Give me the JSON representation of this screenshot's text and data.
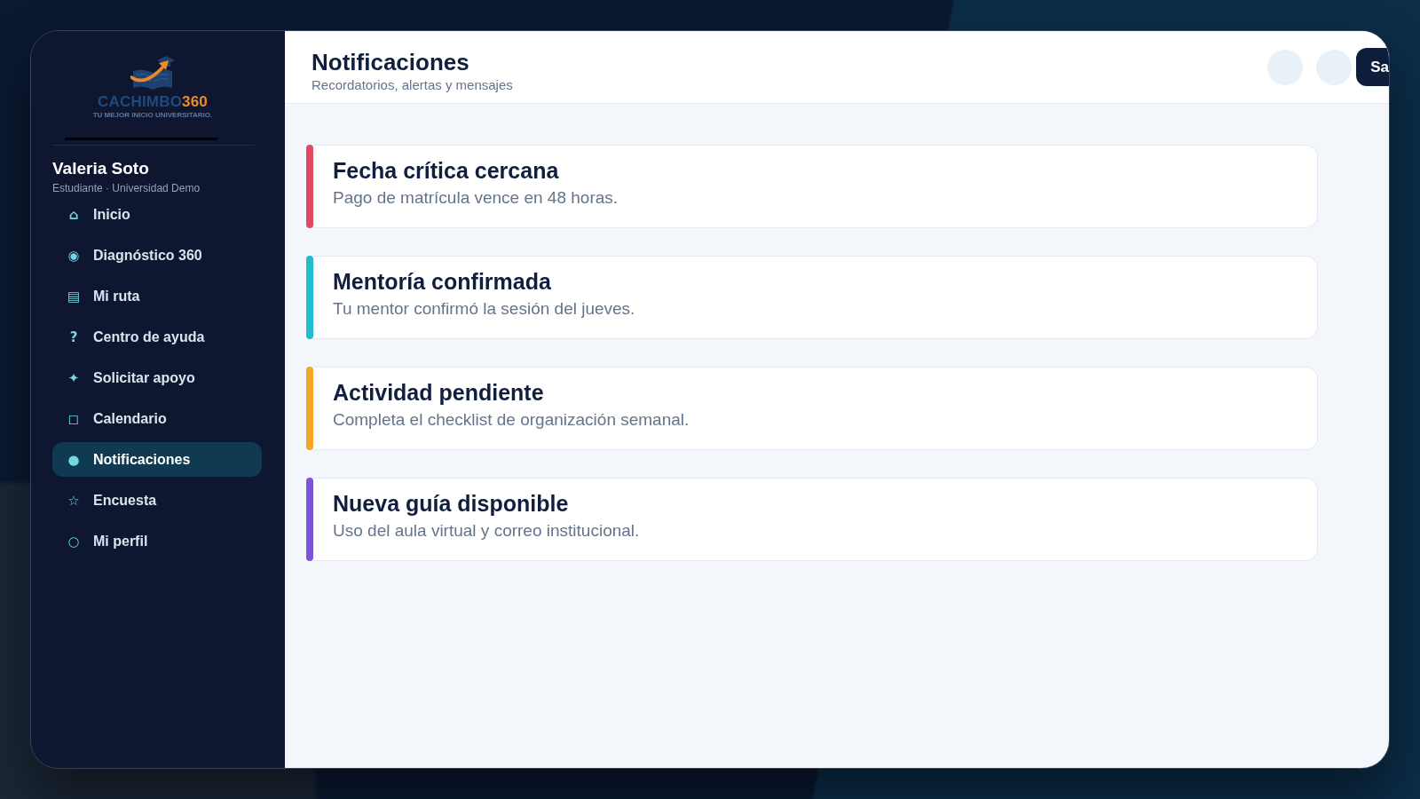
{
  "brand": {
    "name": "CACHIMBO",
    "number": "360",
    "tagline": "TU MEJOR INICIO UNIVERSITARIO."
  },
  "user": {
    "name": "Valeria Soto",
    "role": "Estudiante · Universidad Demo"
  },
  "nav": [
    {
      "icon": "⌂",
      "label": "Inicio",
      "selected": false
    },
    {
      "icon": "◉",
      "label": "Diagnóstico 360",
      "selected": false
    },
    {
      "icon": "▤",
      "label": "Mi ruta",
      "selected": false
    },
    {
      "icon": "?",
      "label": "Centro de ayuda",
      "selected": false
    },
    {
      "icon": "✦",
      "label": "Solicitar apoyo",
      "selected": false
    },
    {
      "icon": "◻",
      "label": "Calendario",
      "selected": false
    },
    {
      "icon": "●",
      "label": "Notificaciones",
      "selected": true
    },
    {
      "icon": "☆",
      "label": "Encuesta",
      "selected": false
    },
    {
      "icon": "○",
      "label": "Mi perfil",
      "selected": false
    }
  ],
  "header": {
    "title": "Notificaciones",
    "subtitle": "Recordatorios, alertas y mensajes",
    "actions": [
      {
        "kind": "circle"
      },
      {
        "kind": "circle"
      },
      {
        "kind": "button",
        "label": "Sa"
      }
    ]
  },
  "notifications": [
    {
      "title": "Fecha crítica cercana",
      "message": "Pago de matrícula vence en 48 horas.",
      "color": "#e04a62"
    },
    {
      "title": "Mentoría confirmada",
      "message": "Tu mentor confirmó la sesión del jueves.",
      "color": "#22bccf"
    },
    {
      "title": "Actividad pendiente",
      "message": "Completa el checklist de organización semanal.",
      "color": "#f5a623"
    },
    {
      "title": "Nueva guía disponible",
      "message": "Uso del aula virtual y correo institucional.",
      "color": "#7b55d9"
    }
  ]
}
